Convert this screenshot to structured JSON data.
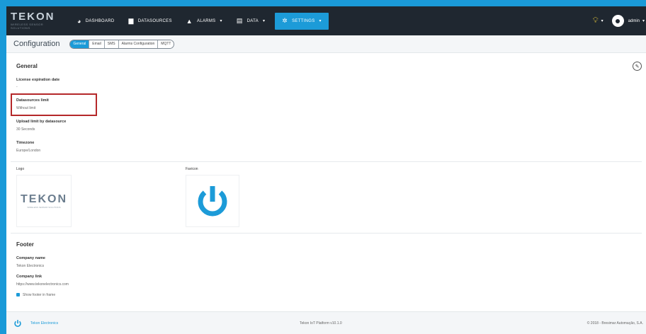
{
  "brand": {
    "name": "TEKON",
    "tagline": "WIRELESS SENSOR SOLUTIONS",
    "accent": "#1c9bd8",
    "navbar": "#1f2730"
  },
  "nav": {
    "items": [
      {
        "label": "DASHBOARD",
        "icon": "dashboard-icon"
      },
      {
        "label": "DATASOURCES",
        "icon": "car-icon"
      },
      {
        "label": "ALARMS",
        "icon": "bell-icon"
      },
      {
        "label": "DATA",
        "icon": "database-icon"
      },
      {
        "label": "SETTINGS",
        "icon": "gear-icon"
      }
    ],
    "user": "admin"
  },
  "page": {
    "title": "Configuration",
    "tabs": [
      "General",
      "Email",
      "SMS",
      "Alarms Configuration",
      "MQTT"
    ],
    "active_tab": "General"
  },
  "general": {
    "title": "General",
    "fields": [
      {
        "label": "License expiration date",
        "value": "-"
      },
      {
        "label": "Datasources limit",
        "value": "Without limit"
      },
      {
        "label": "Upload limit by datasource",
        "value": "30 Seconds"
      },
      {
        "label": "Timezone",
        "value": "Europe/London"
      }
    ],
    "logo_label": "Logo",
    "favicon_label": "Favicon"
  },
  "footer_section": {
    "title": "Footer",
    "company_name_label": "Company name",
    "company_name": "Tekon Electronics",
    "company_link_label": "Company link",
    "company_link": "https://www.tekonelectronics.com",
    "show_footer_label": "Show footer in frame"
  },
  "footer": {
    "link": "Tekon Electronics",
    "center": "Tekon IoT Platform v10.1.0",
    "right": "© 2018 - Bresimar Automação, S.A."
  }
}
